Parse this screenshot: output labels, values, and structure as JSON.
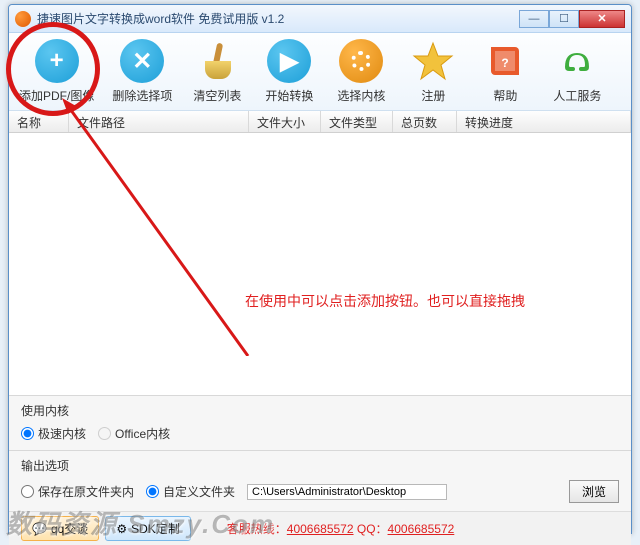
{
  "window": {
    "title": "捷速图片文字转换成word软件 免费试用版 v1.2"
  },
  "toolbar": {
    "add": "添加PDF/图像",
    "delete": "删除选择项",
    "clear": "清空列表",
    "start": "开始转换",
    "engine": "选择内核",
    "register": "注册",
    "help": "帮助",
    "service": "人工服务"
  },
  "columns": {
    "name": "名称",
    "path": "文件路径",
    "size": "文件大小",
    "type": "文件类型",
    "pages": "总页数",
    "progress": "转换进度"
  },
  "annotation": "在使用中可以点击添加按钮。也可以直接拖拽",
  "engine": {
    "heading": "使用内核",
    "fast": "极速内核",
    "office": "Office内核"
  },
  "output": {
    "heading": "输出选项",
    "keep": "保存在原文件夹内",
    "custom": "自定义文件夹",
    "path": "C:\\Users\\Administrator\\Desktop",
    "browse": "浏览"
  },
  "footer": {
    "qq": "qq交谈",
    "sdk": "SDK定制",
    "hotline_label": "客服热线：",
    "phone": "4006685572",
    "qq_label": " QQ：",
    "qq_num": "4006685572"
  },
  "watermark": "数码资源 Smzy.Com"
}
